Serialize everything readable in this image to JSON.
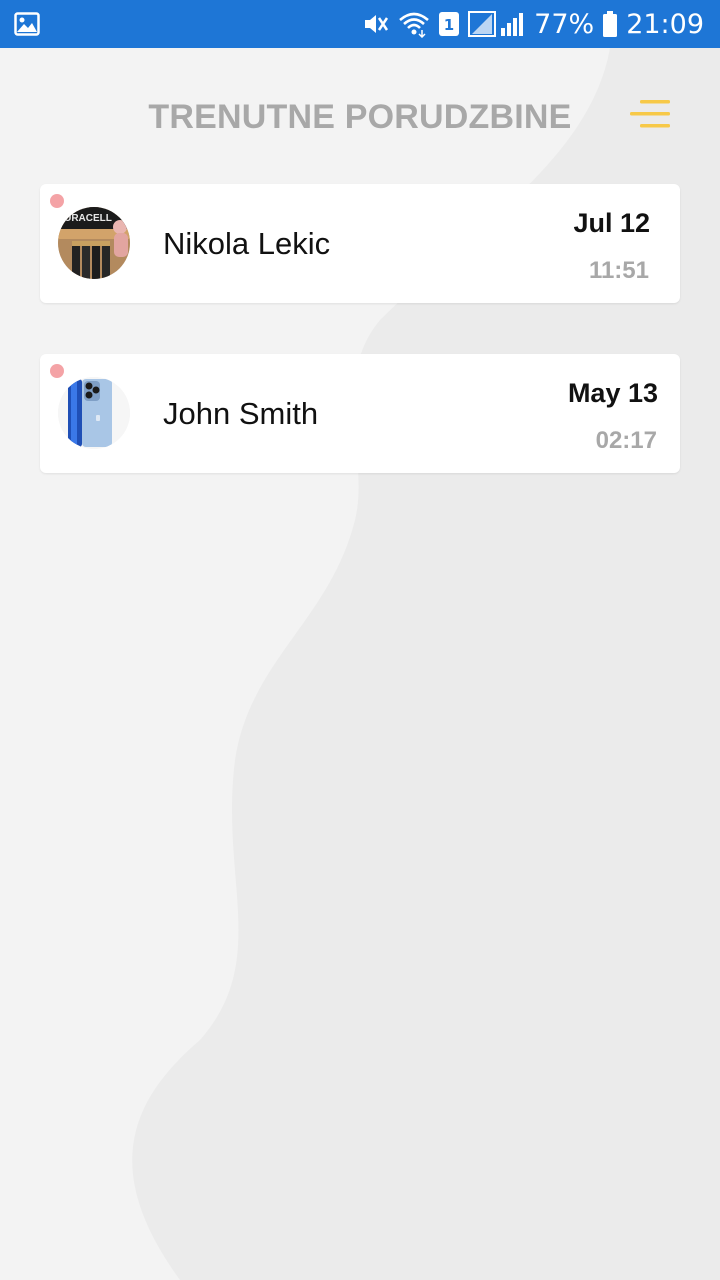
{
  "status_bar": {
    "battery_percent": "77%",
    "time": "21:09",
    "sim_slot": "1",
    "icons": [
      "gallery-icon",
      "mute-vibrate-icon",
      "wifi-icon",
      "sim-icon",
      "signal-icon",
      "battery-icon"
    ]
  },
  "header": {
    "title": "TRENUTNE PORUDZBINE",
    "menu_icon": "menu-icon",
    "menu_color": "#f7c948"
  },
  "orders": [
    {
      "name": "Nikola Lekic",
      "date": "Jul 12",
      "time": "11:51",
      "avatar": "batteries-product-image",
      "unread": true
    },
    {
      "name": "John Smith",
      "date": "May 13",
      "time": "02:17",
      "avatar": "phone-product-image",
      "unread": true
    }
  ],
  "colors": {
    "status_bar": "#1e76d6",
    "title": "#a8a8a8",
    "unread_dot": "#f4a3a6",
    "background": "#f3f3f3"
  }
}
